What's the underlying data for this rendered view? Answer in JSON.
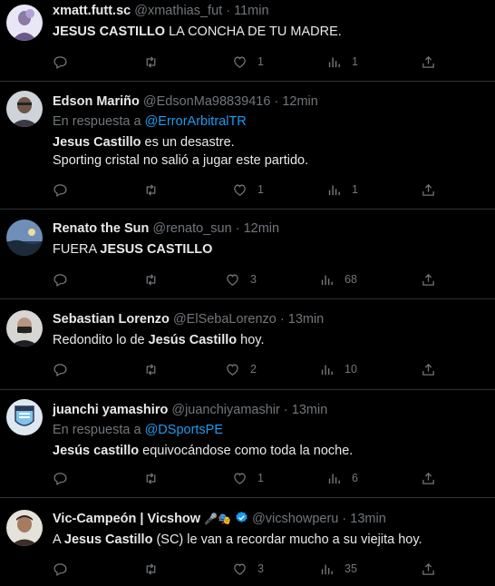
{
  "tweets": [
    {
      "name": "xmatt.futt.sc",
      "handle": "@xmathias_fut",
      "sep": "·",
      "time": "11min",
      "text_bold": "JESUS CASTILLO",
      "text_rest": " LA CONCHA DE TU MADRE.",
      "likes": "1",
      "views": "1"
    },
    {
      "name": "Edson Mariño",
      "handle": "@EdsonMa98839416",
      "sep": "·",
      "time": "12min",
      "reply_prefix": "En respuesta a",
      "reply_to": "@ErrorArbitralTR",
      "text_bold": "Jesus Castillo",
      "text_rest": " es un desastre.",
      "text_line2": "Sporting cristal no salió a jugar este partido.",
      "likes": "1",
      "views": "1"
    },
    {
      "name": "Renato the Sun",
      "handle": "@renato_sun",
      "sep": "·",
      "time": "12min",
      "text_pre": "FUERA ",
      "text_bold": "JESUS CASTILLO",
      "likes": "3",
      "views": "68"
    },
    {
      "name": "Sebastian Lorenzo",
      "handle": "@ElSebaLorenzo",
      "sep": "·",
      "time": "13min",
      "text_pre": "Redondito lo de ",
      "text_bold": "Jesús Castillo",
      "text_rest": " hoy.",
      "likes": "2",
      "views": "10"
    },
    {
      "name": "juanchi yamashiro",
      "handle": "@juanchiyamashir",
      "sep": "·",
      "time": "13min",
      "reply_prefix": "En respuesta a",
      "reply_to": "@DSportsPE",
      "text_bold": "Jesús castillo",
      "text_rest": " equivocándose como toda la noche.",
      "likes": "1",
      "views": "6"
    },
    {
      "name": "Vic-Campeón | Vicshow",
      "emojis": "🎤🎭",
      "handle": "@vicshowperu",
      "sep": "·",
      "time": "13min",
      "text_pre": "A ",
      "text_bold": "Jesus Castillo",
      "text_rest": " (SC) le van a recordar mucho a su viejita hoy.",
      "likes": "3",
      "views": "35"
    }
  ],
  "icons": [
    "reply-icon",
    "retweet-icon",
    "like-icon",
    "views-icon",
    "share-icon"
  ],
  "colors": {
    "background": "#000000",
    "text": "#e7e9ea",
    "muted": "#71767b",
    "link": "#1d9bf0",
    "divider": "#2f3336"
  }
}
